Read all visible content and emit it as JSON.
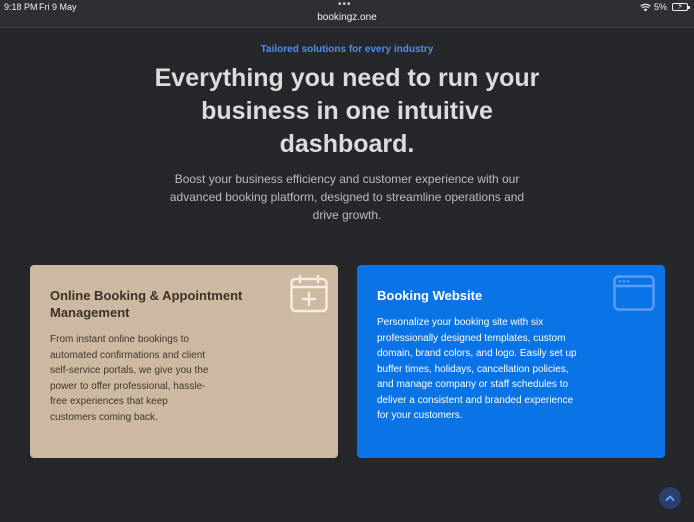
{
  "status_bar": {
    "time": "9:18 PM",
    "date": "Fri 9 May",
    "url": "bookingz.one",
    "battery": "5%"
  },
  "hero": {
    "eyebrow": "Tailored solutions for every industry",
    "headline": "Everything you need to run your business in one intuitive dashboard.",
    "subtext": "Boost your business efficiency and customer experience with our advanced booking platform, designed to streamline operations and drive growth."
  },
  "cards": [
    {
      "title": "Online Booking & Appointment Management",
      "body": "From instant online bookings to automated confirmations and client self-service portals, we give you the power to offer professional, hassle-free experiences that keep customers coming back.",
      "icon": "calendar-plus-icon",
      "background": "#cdb9a1"
    },
    {
      "title": "Booking Website",
      "body": "Personalize your booking site with six professionally designed templates, custom domain, brand colors, and logo. Easily set up buffer times, holidays, cancellation policies, and manage company or staff schedules to deliver a consistent and branded experience for your customers.",
      "icon": "browser-window-icon",
      "background": "#0a73e6"
    }
  ],
  "colors": {
    "page_background": "#25272b",
    "accent": "#4f8df5"
  }
}
